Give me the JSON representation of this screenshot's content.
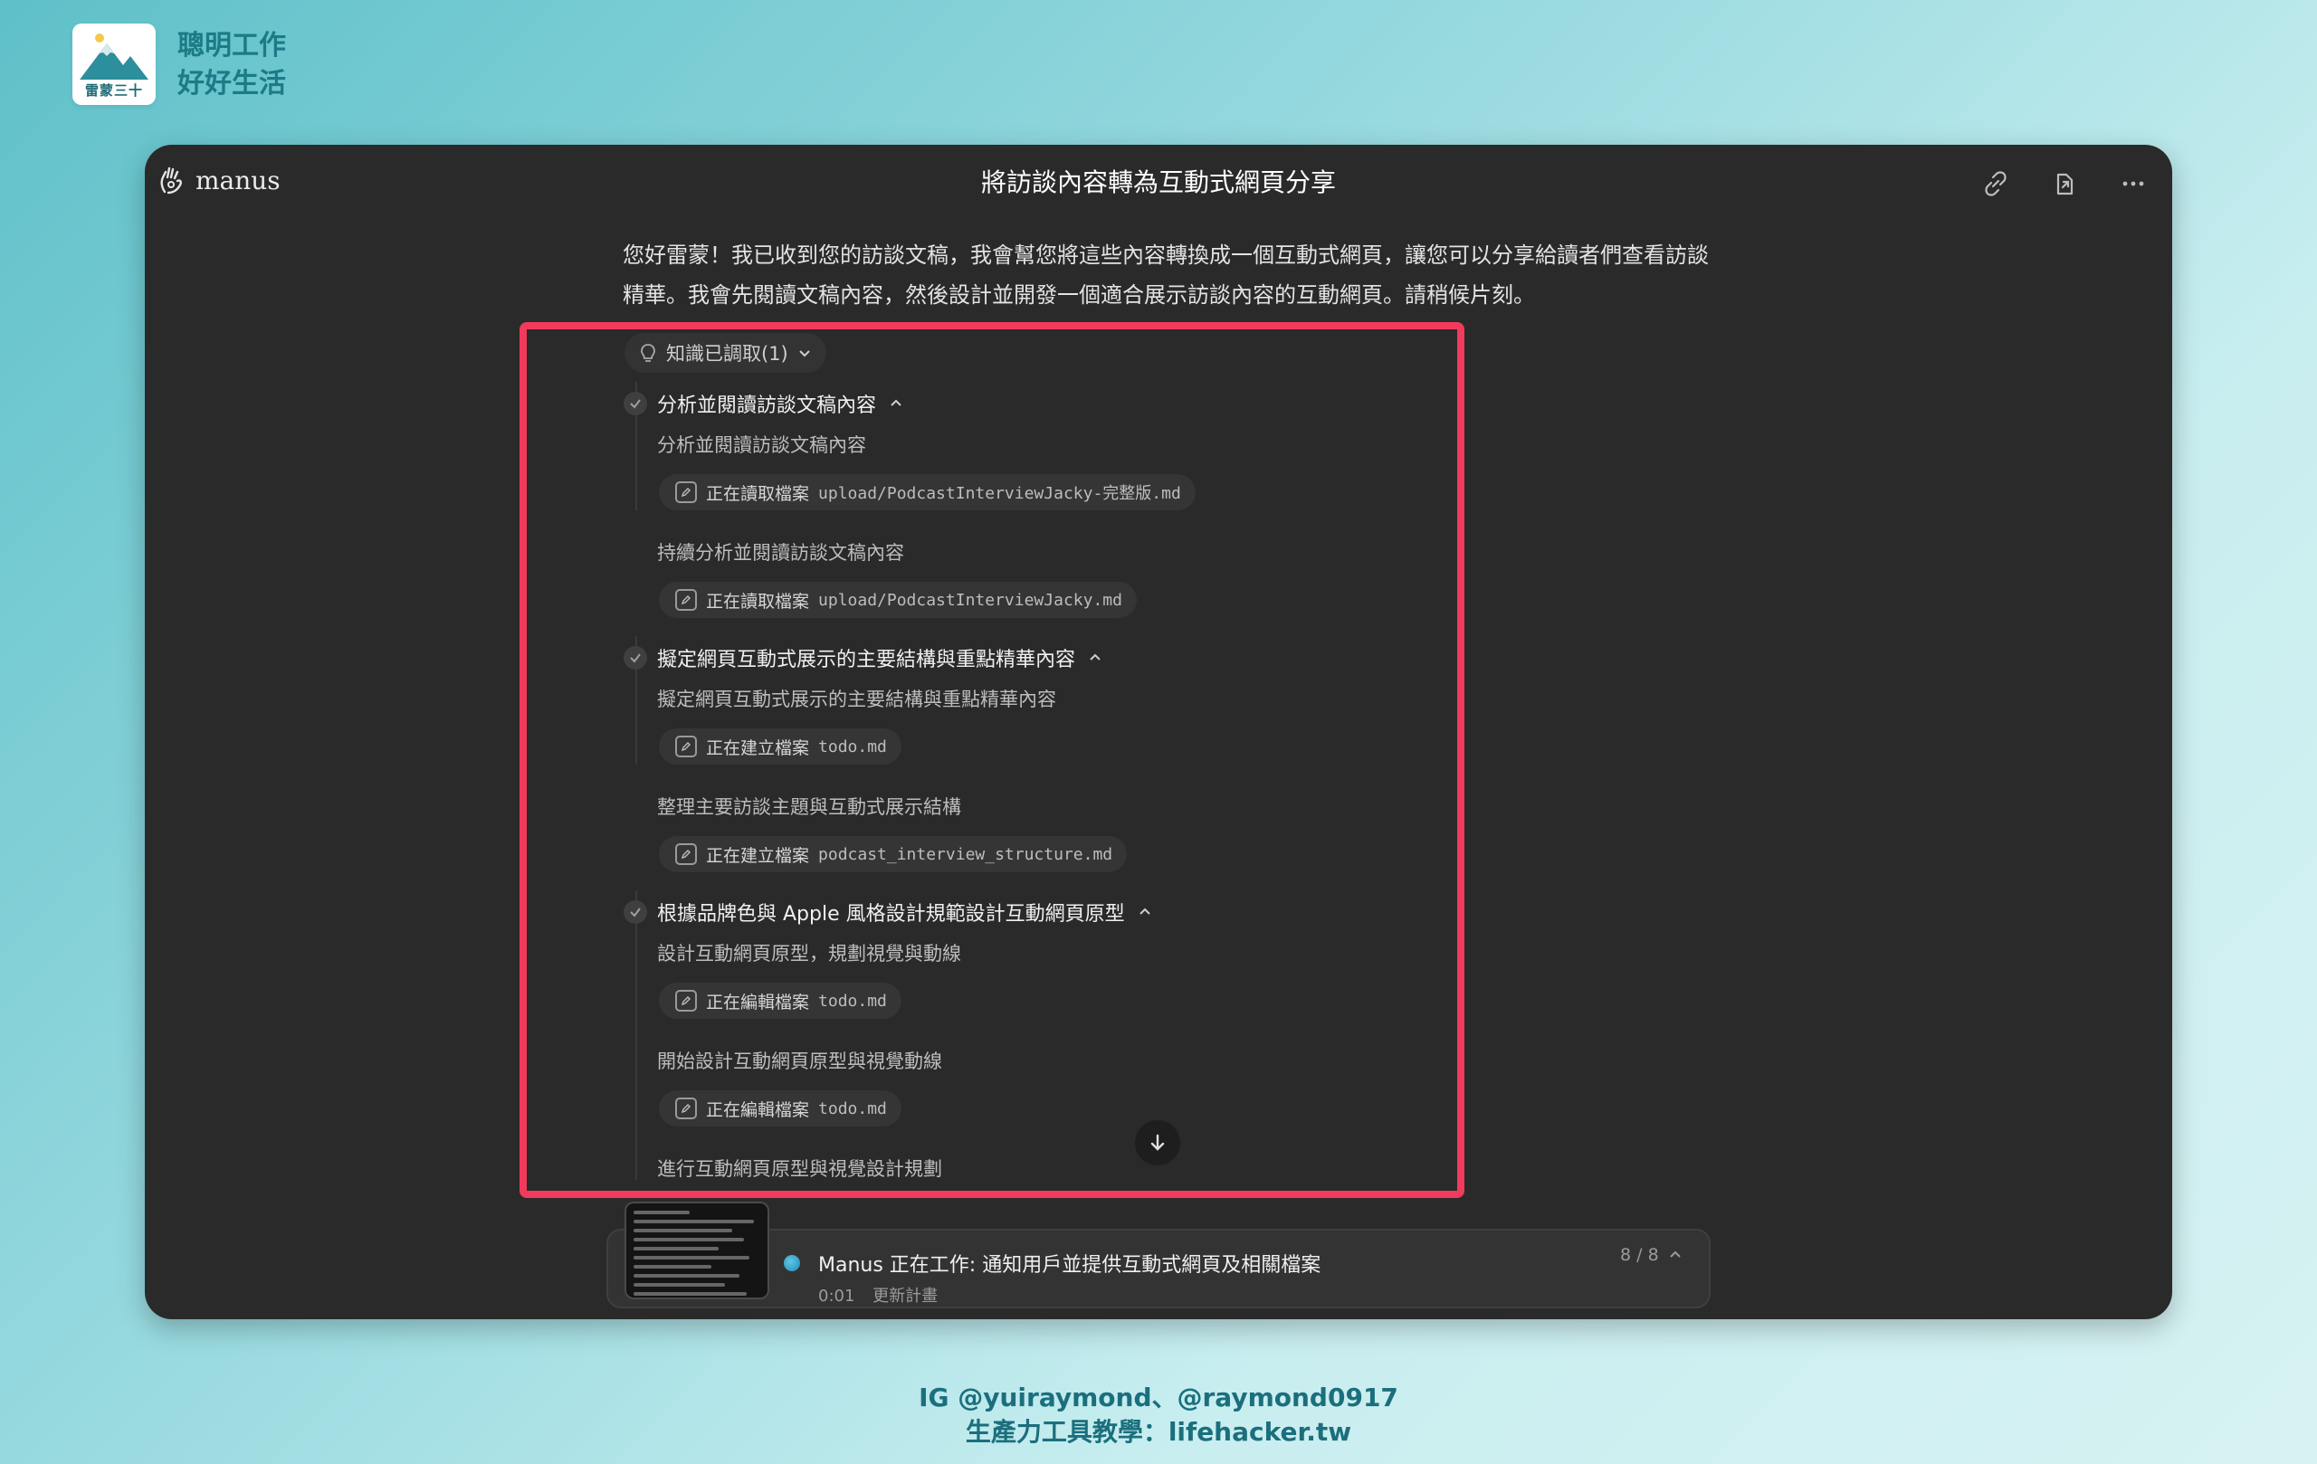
{
  "brand": {
    "logo_caption": "雷蒙三十",
    "line1": "聰明工作",
    "line2": "好好生活"
  },
  "footer": {
    "line1": "IG @yuiraymond、@raymond0917",
    "line2": "生產力工具教學：lifehacker.tw"
  },
  "window": {
    "app_name": "manus",
    "title": "將訪談內容轉為互動式網頁分享",
    "icons": [
      "link-icon",
      "share-icon",
      "more-icon"
    ]
  },
  "intro": "您好雷蒙！我已收到您的訪談文稿，我會幫您將這些內容轉換成一個互動式網頁，讓您可以分享給讀者們查看訪談精華。我會先閱讀文稿內容，然後設計並開發一個適合展示訪談內容的互動網頁。請稍候片刻。",
  "knowledge": {
    "label": "知識已調取(1)"
  },
  "steps": [
    {
      "title": "分析並閱讀訪談文稿內容",
      "items": [
        {
          "type": "text",
          "text": "分析並閱讀訪談文稿內容"
        },
        {
          "type": "file",
          "action": "正在讀取檔案",
          "path": "upload/PodcastInterviewJacky-完整版.md"
        },
        {
          "type": "text",
          "text": "持續分析並閱讀訪談文稿內容"
        },
        {
          "type": "file",
          "action": "正在讀取檔案",
          "path": "upload/PodcastInterviewJacky.md"
        }
      ]
    },
    {
      "title": "擬定網頁互動式展示的主要結構與重點精華內容",
      "items": [
        {
          "type": "text",
          "text": "擬定網頁互動式展示的主要結構與重點精華內容"
        },
        {
          "type": "file",
          "action": "正在建立檔案",
          "path": "todo.md"
        },
        {
          "type": "text",
          "text": "整理主要訪談主題與互動式展示結構"
        },
        {
          "type": "file",
          "action": "正在建立檔案",
          "path": "podcast_interview_structure.md"
        }
      ]
    },
    {
      "title": "根據品牌色與 Apple 風格設計規範設計互動網頁原型",
      "items": [
        {
          "type": "text",
          "text": "設計互動網頁原型，規劃視覺與動線"
        },
        {
          "type": "file",
          "action": "正在編輯檔案",
          "path": "todo.md"
        },
        {
          "type": "text",
          "text": "開始設計互動網頁原型與視覺動線"
        },
        {
          "type": "file",
          "action": "正在編輯檔案",
          "path": "todo.md"
        },
        {
          "type": "text",
          "text": "進行互動網頁原型與視覺設計規劃"
        }
      ]
    }
  ],
  "task": {
    "title": "Manus 正在工作: 通知用戶並提供互動式網頁及相關檔案",
    "time": "0:01",
    "status": "更新計畫",
    "progress": "8 / 8"
  },
  "colors": {
    "highlight_border": "#f23b5c",
    "window_bg": "#2a2a2a",
    "brand_text": "#1b7b86"
  }
}
